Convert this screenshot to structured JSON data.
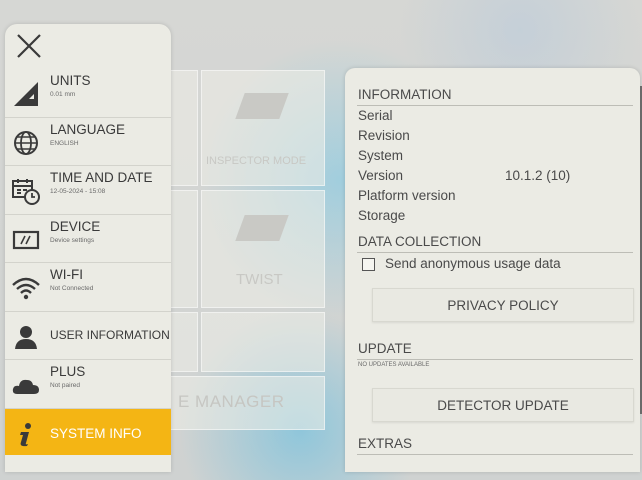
{
  "background": {
    "tiles": [
      "INSPECTOR MODE",
      "TWIST",
      ""
    ],
    "manager_label": "E MANAGER"
  },
  "sidebar": {
    "items": [
      {
        "title": "UNITS",
        "subtitle": "0.01 mm",
        "icon": "ruler-triangle-icon"
      },
      {
        "title": "LANGUAGE",
        "subtitle": "ENGLISH",
        "icon": "globe-icon"
      },
      {
        "title": "TIME AND DATE",
        "subtitle": "12-05-2024 - 15:08",
        "icon": "calendar-clock-icon"
      },
      {
        "title": "DEVICE",
        "subtitle": "Device settings",
        "icon": "device-icon"
      },
      {
        "title": "WI-FI",
        "subtitle": "Not Connected",
        "icon": "wifi-icon"
      },
      {
        "title": "USER INFORMATION",
        "subtitle": "",
        "icon": "user-icon"
      },
      {
        "title": "PLUS",
        "subtitle": "Not paired",
        "icon": "cloud-icon"
      },
      {
        "title": "SYSTEM INFO",
        "subtitle": "",
        "icon": "info-icon",
        "active": true
      }
    ]
  },
  "info": {
    "information_heading": "INFORMATION",
    "rows": [
      {
        "label": "Serial",
        "value": ""
      },
      {
        "label": "Revision",
        "value": ""
      },
      {
        "label": "System",
        "value": ""
      },
      {
        "label": "Version",
        "value": "10.1.2 (10)"
      },
      {
        "label": "Platform version",
        "value": ""
      },
      {
        "label": "Storage",
        "value": ""
      }
    ],
    "data_collection_heading": "DATA COLLECTION",
    "send_usage_label": "Send anonymous usage data",
    "send_usage_checked": false,
    "privacy_policy_label": "PRIVACY POLICY",
    "update_heading": "UPDATE",
    "update_status": "NO UPDATES AVAILABLE",
    "detector_update_label": "DETECTOR UPDATE",
    "extras_heading": "EXTRAS"
  },
  "colors": {
    "accent": "#f4b514",
    "panel": "#ebebe4",
    "text": "#4a4a4a"
  }
}
